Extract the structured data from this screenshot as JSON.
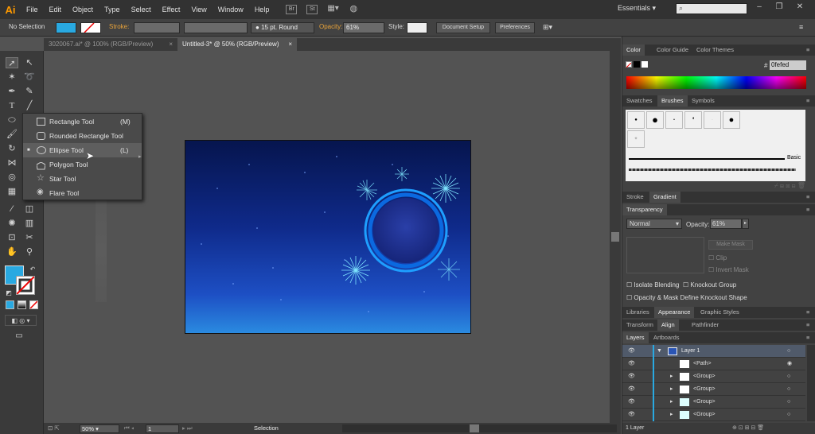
{
  "menubar": {
    "logo": "Ai",
    "items": [
      "File",
      "Edit",
      "Object",
      "Type",
      "Select",
      "Effect",
      "View",
      "Window",
      "Help"
    ],
    "icons": [
      "Br",
      "St"
    ],
    "workspace": "Essentials",
    "search_placeholder": ""
  },
  "control": {
    "selection": "No Selection",
    "stroke_label": "Stroke:",
    "brush": "15 pt. Round",
    "opacity_label": "Opacity:",
    "opacity": "61%",
    "style_label": "Style:",
    "doc_setup": "Document Setup",
    "preferences": "Preferences"
  },
  "tabs": [
    {
      "label": "3020067.ai* @ 100% (RGB/Preview)",
      "active": false
    },
    {
      "label": "Untitled-3* @ 50% (RGB/Preview)",
      "active": true
    }
  ],
  "flyout": {
    "items": [
      {
        "label": "Rectangle Tool",
        "shortcut": "(M)",
        "icon": "rectangle-icon"
      },
      {
        "label": "Rounded Rectangle Tool",
        "shortcut": "",
        "icon": "rounded-rectangle-icon"
      },
      {
        "label": "Ellipse Tool",
        "shortcut": "(L)",
        "icon": "ellipse-icon",
        "selected": true
      },
      {
        "label": "Polygon Tool",
        "shortcut": "",
        "icon": "polygon-icon"
      },
      {
        "label": "Star Tool",
        "shortcut": "",
        "icon": "star-icon"
      },
      {
        "label": "Flare Tool",
        "shortcut": "",
        "icon": "flare-icon"
      }
    ]
  },
  "status": {
    "zoom": "50%",
    "page": "1",
    "tool": "Selection"
  },
  "panels": {
    "color_tabs": [
      "Color",
      "Color Guide",
      "Color Themes"
    ],
    "hex_prefix": "#",
    "hex": "0fefed",
    "brush_tabs": [
      "Swatches",
      "Brushes",
      "Symbols"
    ],
    "basic_label": "Basic",
    "stroke_tabs": [
      "Stroke",
      "Gradient"
    ],
    "transparency_tab": "Transparency",
    "blend_mode": "Normal",
    "opacity_label": "Opacity:",
    "opacity": "61%",
    "make_mask": "Make Mask",
    "clip": "Clip",
    "invert_mask": "Invert Mask",
    "isolate": "Isolate Blending",
    "knockout": "Knockout Group",
    "opacity_mask": "Opacity & Mask Define Knockout Shape",
    "lib_tabs": [
      "Libraries",
      "Appearance",
      "Graphic Styles"
    ],
    "align_tabs": [
      "Transform",
      "Align",
      "Pathfinder"
    ],
    "layer_tabs": [
      "Layers",
      "Artboards"
    ],
    "layers": [
      {
        "name": "Layer 1"
      },
      {
        "name": "<Path>"
      },
      {
        "name": "<Group>"
      },
      {
        "name": "<Group>"
      },
      {
        "name": "<Group>"
      },
      {
        "name": "<Group>"
      }
    ],
    "layer_count": "1 Layer"
  },
  "colors": {
    "accent": "#29a9e1",
    "orange": "#e8a33a",
    "panel": "#424242"
  }
}
